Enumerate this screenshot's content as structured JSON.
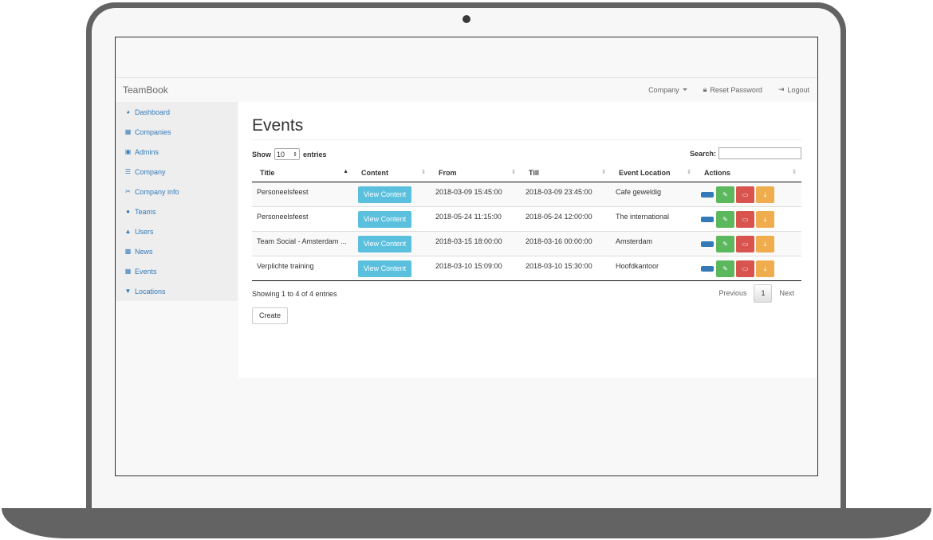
{
  "app": {
    "brand": "TeamBook"
  },
  "navbar": {
    "company_label": "Company",
    "reset_password_label": "Reset Password",
    "logout_label": "Logout"
  },
  "sidebar": {
    "items": [
      {
        "label": "Dashboard",
        "icon": "dashboard-icon"
      },
      {
        "label": "Companies",
        "icon": "building-icon"
      },
      {
        "label": "Admins",
        "icon": "lock-icon"
      },
      {
        "label": "Company",
        "icon": "sliders-icon"
      },
      {
        "label": "Company info",
        "icon": "scissors-icon"
      },
      {
        "label": "Teams",
        "icon": "users-icon"
      },
      {
        "label": "Users",
        "icon": "user-icon"
      },
      {
        "label": "News",
        "icon": "document-icon"
      },
      {
        "label": "Events",
        "icon": "calendar-icon"
      },
      {
        "label": "Locations",
        "icon": "map-marker-icon"
      }
    ]
  },
  "page": {
    "title": "Events",
    "show_label": "Show",
    "entries_label": "entries",
    "page_length": "10",
    "search_label": "Search:",
    "search_value": ""
  },
  "table": {
    "columns": [
      "Title",
      "Content",
      "From",
      "Till",
      "Event Location",
      "Actions"
    ],
    "view_content_label": "View Content",
    "rows": [
      {
        "title": "Personeelsfeest",
        "from": "2018-03-09 15:45:00",
        "till": "2018-03-09 23:45:00",
        "location": "Cafe geweldig"
      },
      {
        "title": "Personeelsfeest",
        "from": "2018-05-24 11:15:00",
        "till": "2018-05-24 12:00:00",
        "location": "The international"
      },
      {
        "title": "Team Social - Amsterdam ...",
        "from": "2018-03-15 18:00:00",
        "till": "2018-03-16 00:00:00",
        "location": "Amsterdam"
      },
      {
        "title": "Verplichte training",
        "from": "2018-03-10 15:09:00",
        "till": "2018-03-10 15:30:00",
        "location": "Hoofdkantoor"
      }
    ]
  },
  "footer": {
    "info": "Showing 1 to 4 of 4 entries",
    "previous_label": "Previous",
    "current_page": "1",
    "next_label": "Next",
    "create_label": "Create"
  },
  "colors": {
    "link": "#337ab7",
    "info_button": "#5bc0de",
    "success": "#5cb85c",
    "danger": "#d9534f",
    "warning": "#f0ad4e"
  }
}
